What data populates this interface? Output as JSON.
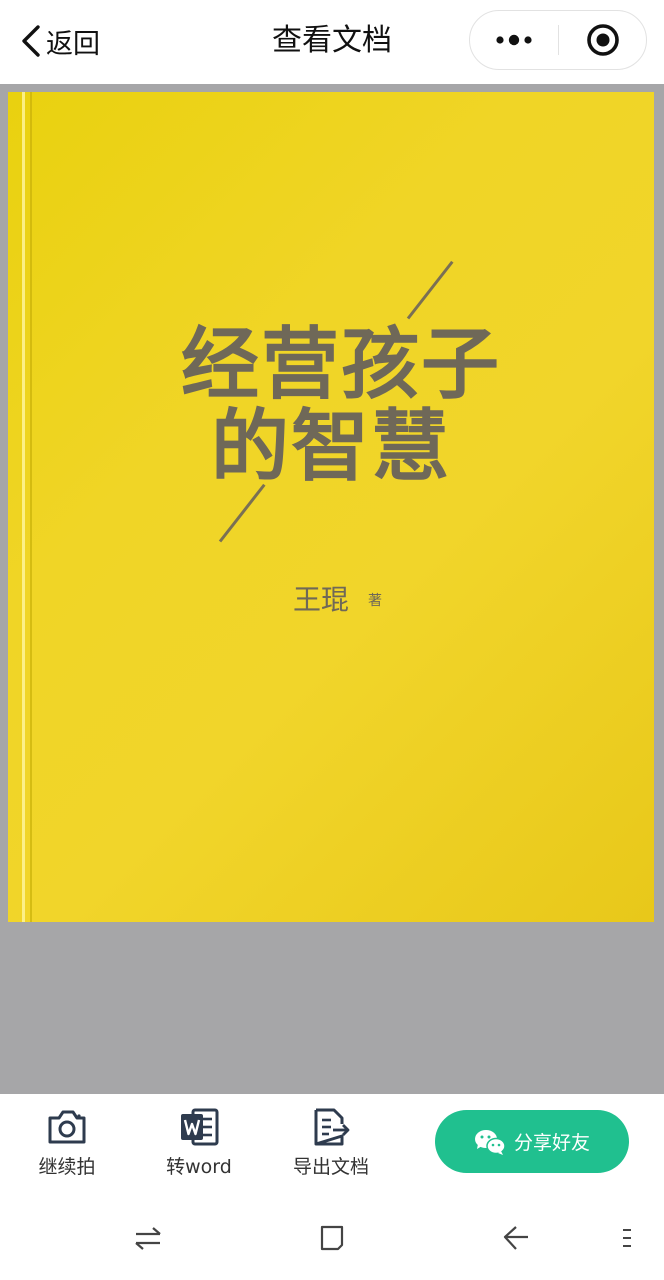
{
  "header": {
    "back_label": "返回",
    "title": "查看文档",
    "more_icon": "more-dots-icon",
    "target_icon": "target-close-icon"
  },
  "document": {
    "title_line1": "经营孩子",
    "title_line2": "的智慧",
    "author": "王琨",
    "author_suffix": "著",
    "cover_color": "#f0d526"
  },
  "toolbar": {
    "items": [
      {
        "label": "继续拍",
        "icon": "camera-icon"
      },
      {
        "label": "转word",
        "icon": "word-icon"
      },
      {
        "label": "导出文档",
        "icon": "export-doc-icon"
      }
    ],
    "share_label": "分享好友",
    "share_icon": "wechat-icon",
    "accent": "#20c08f"
  },
  "navbar": {
    "icons": [
      "recent-apps-icon",
      "home-icon",
      "back-arrow-icon",
      "menu-icon"
    ]
  }
}
